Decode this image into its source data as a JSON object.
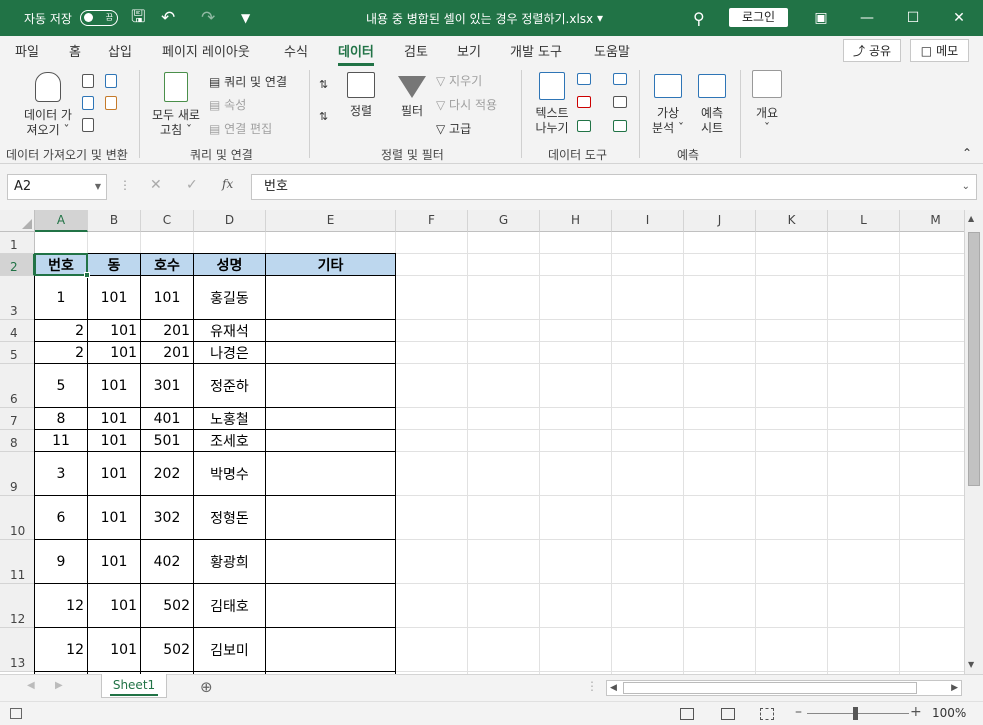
{
  "titlebar": {
    "autosave_label": "자동 저장",
    "toggle_state": "끔",
    "doc_title": "내용 중 병합된 셀이 있는 경우 정렬하기.xlsx",
    "login": "로그인"
  },
  "tabs": [
    "파일",
    "홈",
    "삽입",
    "페이지 레이아웃",
    "수식",
    "데이터",
    "검토",
    "보기",
    "개발 도구",
    "도움말"
  ],
  "active_tab": "데이터",
  "share": "공유",
  "memo": "메모",
  "ribbon": {
    "get_data": [
      "데이터 가",
      "져오기"
    ],
    "refresh_all": [
      "모두 새로",
      "고침"
    ],
    "queries": "쿼리 및 연결",
    "properties": "속성",
    "edit_links": "연결 편집",
    "sort": "정렬",
    "filter": "필터",
    "clear": "지우기",
    "reapply": "다시 적용",
    "advanced": "고급",
    "text_to_columns": [
      "텍스트",
      "나누기"
    ],
    "whatif": [
      "가상",
      "분석"
    ],
    "forecast_sheet": [
      "예측",
      "시트"
    ],
    "outline": "개요",
    "groups": [
      "데이터 가져오기 및 변환",
      "쿼리 및 연결",
      "정렬 및 필터",
      "데이터 도구",
      "예측"
    ]
  },
  "formula": {
    "name_box": "A2",
    "value": "번호"
  },
  "columns": [
    "A",
    "B",
    "C",
    "D",
    "E",
    "F",
    "G",
    "H",
    "I",
    "J",
    "K",
    "L",
    "M"
  ],
  "rows": [
    "1",
    "2",
    "3",
    "4",
    "5",
    "6",
    "7",
    "8",
    "9",
    "10",
    "11",
    "12",
    "13"
  ],
  "table": {
    "headers": [
      "번호",
      "동",
      "호수",
      "성명",
      "기타"
    ],
    "data": [
      [
        "1",
        "101",
        "101",
        "홍길동",
        ""
      ],
      [
        "2",
        "101",
        "201",
        "유재석",
        ""
      ],
      [
        "2",
        "101",
        "201",
        "나경은",
        ""
      ],
      [
        "5",
        "101",
        "301",
        "정준하",
        ""
      ],
      [
        "8",
        "101",
        "401",
        "노홍철",
        ""
      ],
      [
        "11",
        "101",
        "501",
        "조세호",
        ""
      ],
      [
        "3",
        "101",
        "202",
        "박명수",
        ""
      ],
      [
        "6",
        "101",
        "302",
        "정형돈",
        ""
      ],
      [
        "9",
        "101",
        "402",
        "황광희",
        ""
      ],
      [
        "12",
        "101",
        "502",
        "김태호",
        ""
      ],
      [
        "12",
        "101",
        "502",
        "김보미",
        ""
      ]
    ]
  },
  "sheet_tab": "Sheet1",
  "zoom": "100%",
  "colors": {
    "accent": "#217346",
    "header_fill": "#bdd7ee"
  }
}
